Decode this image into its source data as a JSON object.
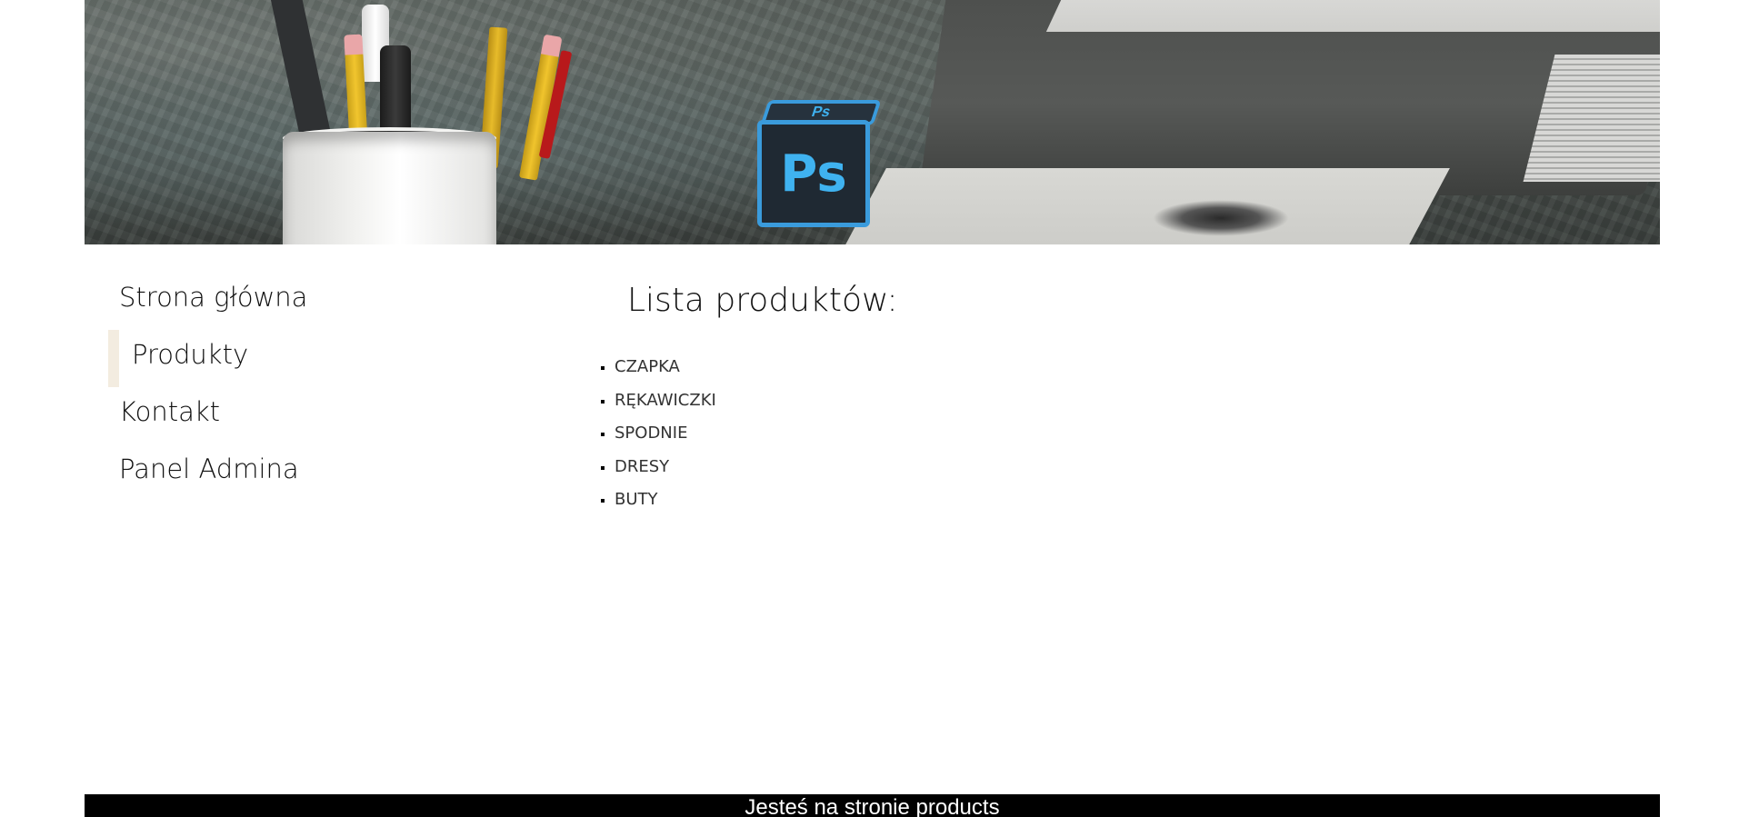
{
  "header": {
    "banner_icon": "photoshop-cube-icon",
    "ps_text": "Ps"
  },
  "sidebar": {
    "items": [
      {
        "label": "Strona główna"
      },
      {
        "label": "Produkty",
        "active": true
      },
      {
        "label": "Kontakt"
      },
      {
        "label": "Panel Admina"
      }
    ]
  },
  "main": {
    "title": "Lista produktów:",
    "products": [
      "CZAPKA",
      "RĘKAWICZKI",
      "SPODNIE",
      "DRESY",
      "BUTY"
    ]
  },
  "footer": {
    "text": "Jesteś na stronie products"
  },
  "colors": {
    "active_marker": "#f3ece0",
    "footer_bg": "#000000",
    "footer_text": "#ffffff"
  }
}
